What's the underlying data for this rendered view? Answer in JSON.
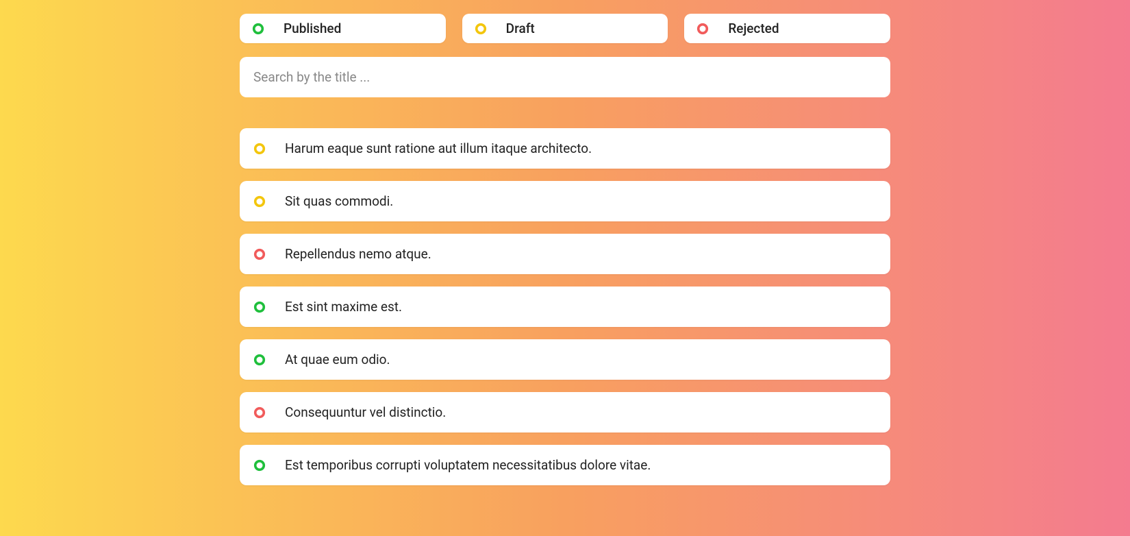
{
  "colors": {
    "published": "#1fbf3c",
    "draft": "#f3c60d",
    "rejected": "#f15b5b"
  },
  "filters": [
    {
      "status": "published",
      "label": "Published"
    },
    {
      "status": "draft",
      "label": "Draft"
    },
    {
      "status": "rejected",
      "label": "Rejected"
    }
  ],
  "search": {
    "placeholder": "Search by the title ...",
    "value": ""
  },
  "items": [
    {
      "status": "draft",
      "title": "Harum eaque sunt ratione aut illum itaque architecto."
    },
    {
      "status": "draft",
      "title": "Sit quas commodi."
    },
    {
      "status": "rejected",
      "title": "Repellendus nemo atque."
    },
    {
      "status": "published",
      "title": "Est sint maxime est."
    },
    {
      "status": "published",
      "title": "At quae eum odio."
    },
    {
      "status": "rejected",
      "title": "Consequuntur vel distinctio."
    },
    {
      "status": "published",
      "title": "Est temporibus corrupti voluptatem necessitatibus dolore vitae."
    }
  ]
}
